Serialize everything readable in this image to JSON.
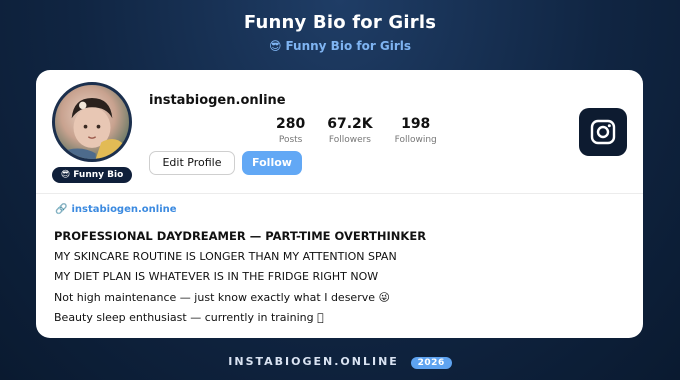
{
  "header": {
    "title": "Funny Bio for Girls",
    "subtitle_emoji": "😎",
    "subtitle": "Funny Bio for Girls"
  },
  "profile": {
    "username": "instabiogen.online",
    "badge_emoji": "😎",
    "badge": "Funny Bio",
    "stats": [
      {
        "value": "280",
        "label": "Posts"
      },
      {
        "value": "67.2K",
        "label": "Followers"
      },
      {
        "value": "198",
        "label": "Following"
      }
    ],
    "edit_label": "Edit Profile",
    "follow_label": "Follow",
    "link": "instabiogen.online",
    "bio": [
      "PROFESSIONAL DAYDREAMER — PART-TIME OVERTHINKER",
      "MY SKINCARE ROUTINE IS LONGER THAN MY ATTENTION SPAN",
      "MY DIET PLAN IS WHATEVER IS IN THE FRIDGE RIGHT NOW",
      "Not high maintenance — just know exactly what I deserve 😜",
      "Beauty sleep enthusiast — currently in training 🏻"
    ]
  },
  "footer": {
    "site": "INSTABIOGEN.ONLINE",
    "year": "2026"
  },
  "colors": {
    "background": "#102542",
    "accent": "#62a8f5",
    "link": "#3b8ae0",
    "icon_tile": "#0d1b30"
  },
  "icons": {
    "instagram": "instagram-icon",
    "link": "link-icon"
  }
}
